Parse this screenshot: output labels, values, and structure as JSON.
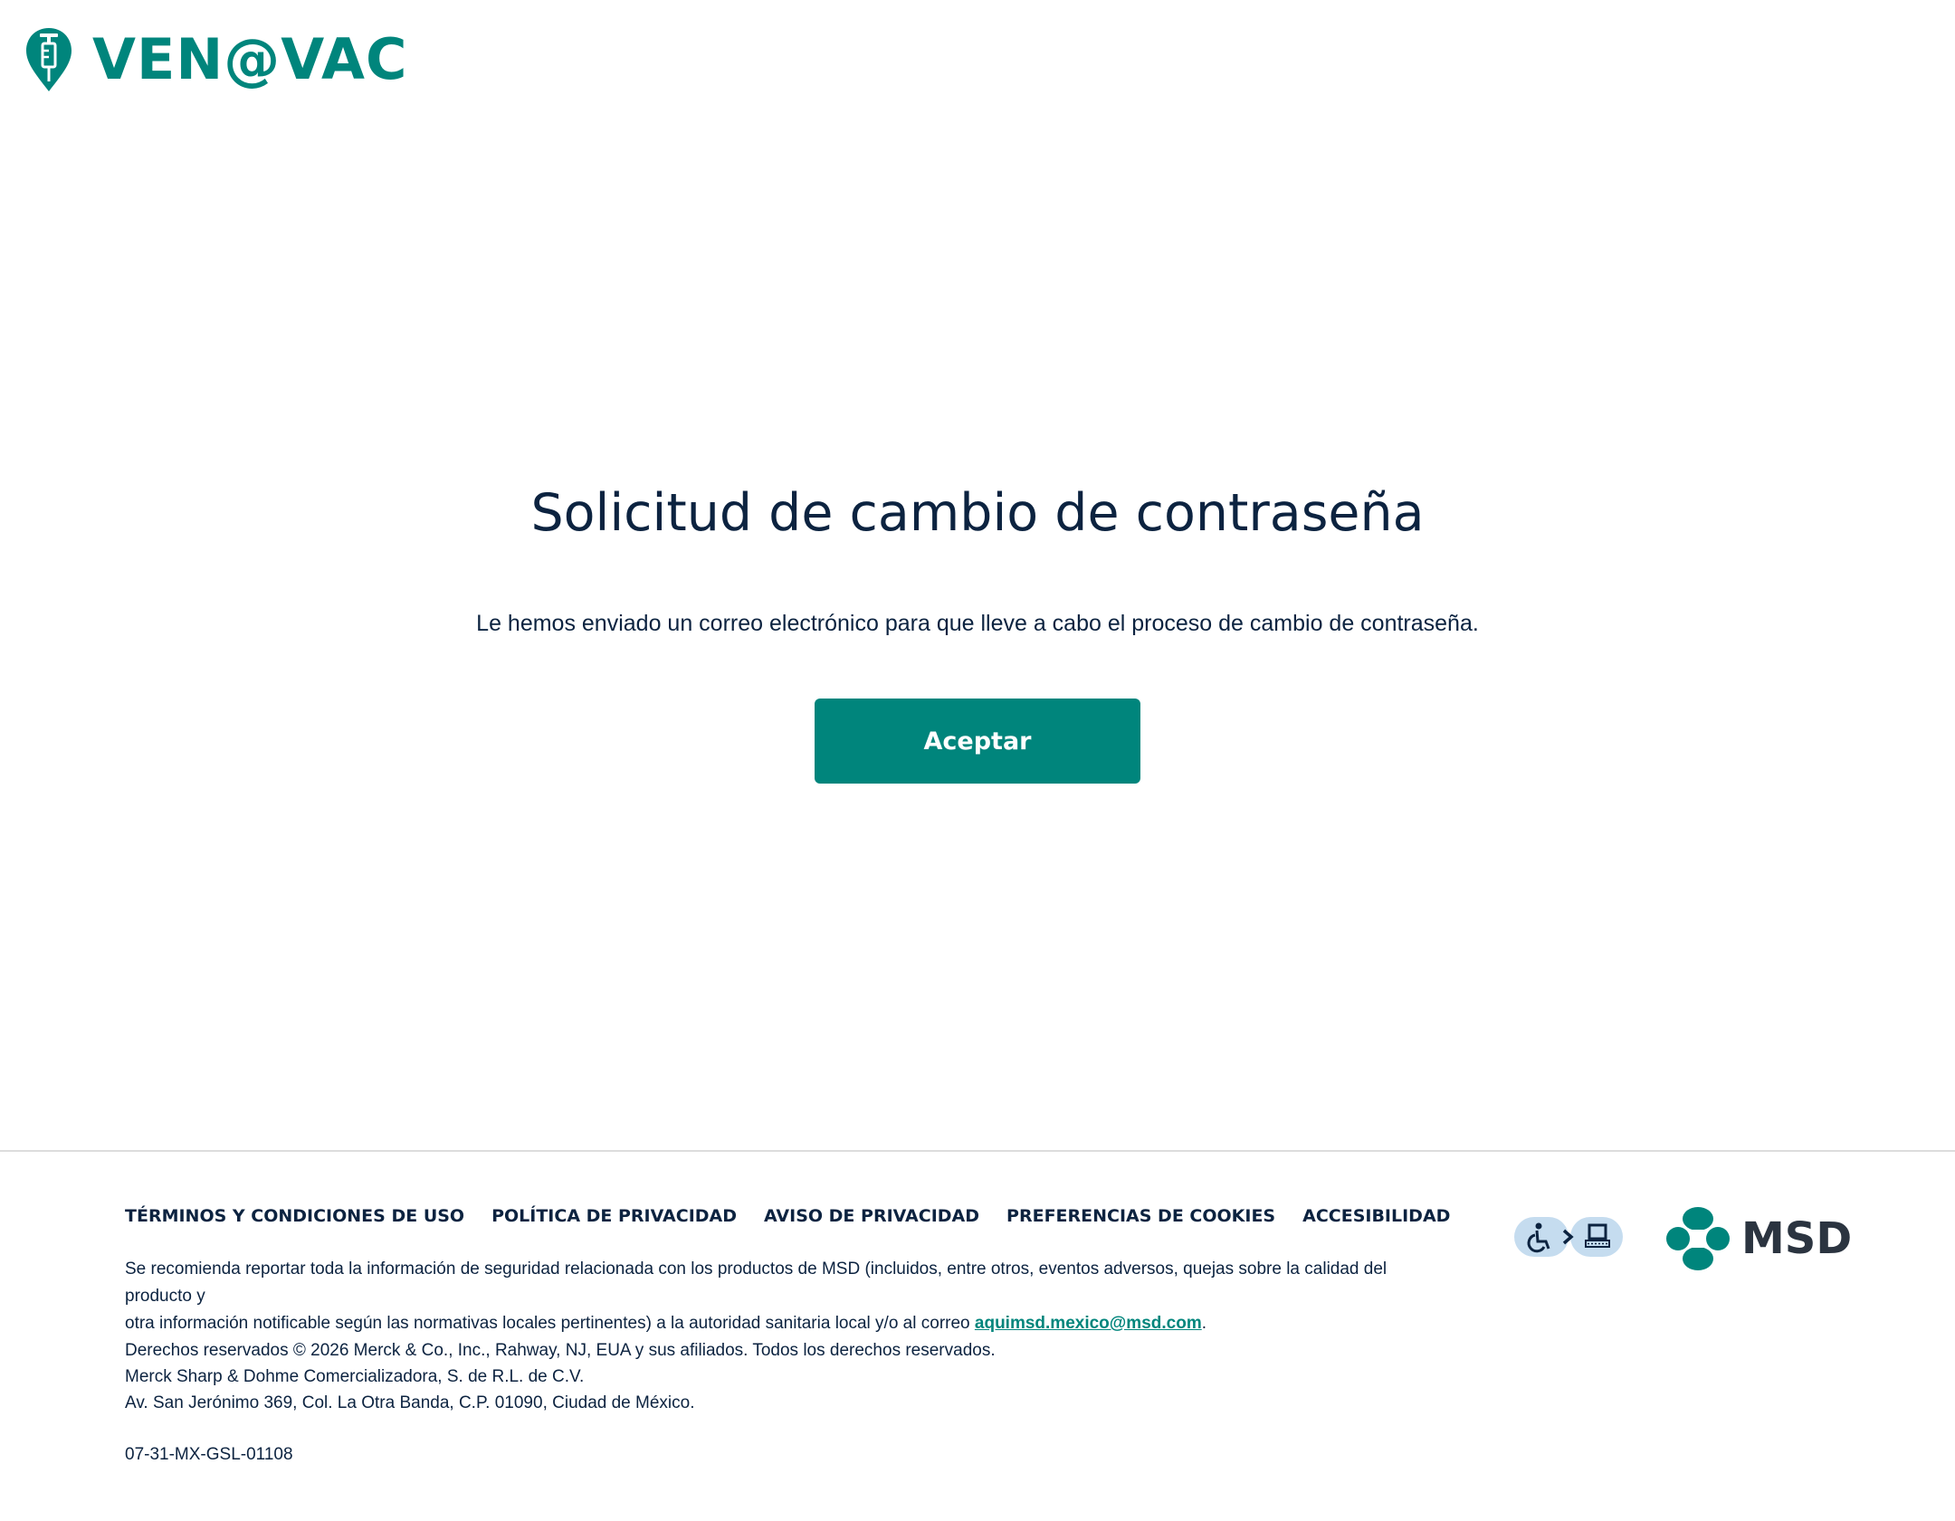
{
  "header": {
    "logo_text": "VEN@VAC",
    "logo_icon": "syringe-pin-icon"
  },
  "main": {
    "title": "Solicitud de cambio de contraseña",
    "message": "Le hemos enviado un correo electrónico para que lleve a cabo el proceso de cambio de contraseña.",
    "accept_label": "Aceptar"
  },
  "footer": {
    "links": [
      "TÉRMINOS Y CONDICIONES DE USO",
      "POLÍTICA DE PRIVACIDAD",
      "AVISO DE PRIVACIDAD",
      "PREFERENCIAS DE COOKIES",
      "ACCESIBILIDAD"
    ],
    "safety_line1": "Se recomienda reportar toda la información de seguridad relacionada con los productos de MSD (incluidos, entre otros, eventos adversos, quejas sobre la calidad del producto y",
    "safety_line2": "otra información notificable según las normativas locales pertinentes) a la autoridad sanitaria local y/o al correo",
    "safety_email": "aquimsd.mexico@msd.com",
    "safety_end": ".",
    "rights_line1": "Derechos reservados © 2026 Merck & Co., Inc., Rahway, NJ, EUA y sus afiliados. Todos los derechos reservados.",
    "rights_line2": "Merck Sharp & Dohme Comercializadora, S. de R.L. de C.V.",
    "rights_line3": "Av. San Jerónimo 369, Col. La Otra Banda, C.P. 01090, Ciudad de México.",
    "code": "07-31-MX-GSL-01108",
    "accessibility_badge_icon": "accessibility-badge-icon",
    "msd_logo_text": "MSD",
    "msd_logo_icon": "msd-logo-icon"
  },
  "colors": {
    "brand_teal": "#00857c",
    "text_navy": "#0c2340",
    "badge_blue": "#c5dcef"
  }
}
